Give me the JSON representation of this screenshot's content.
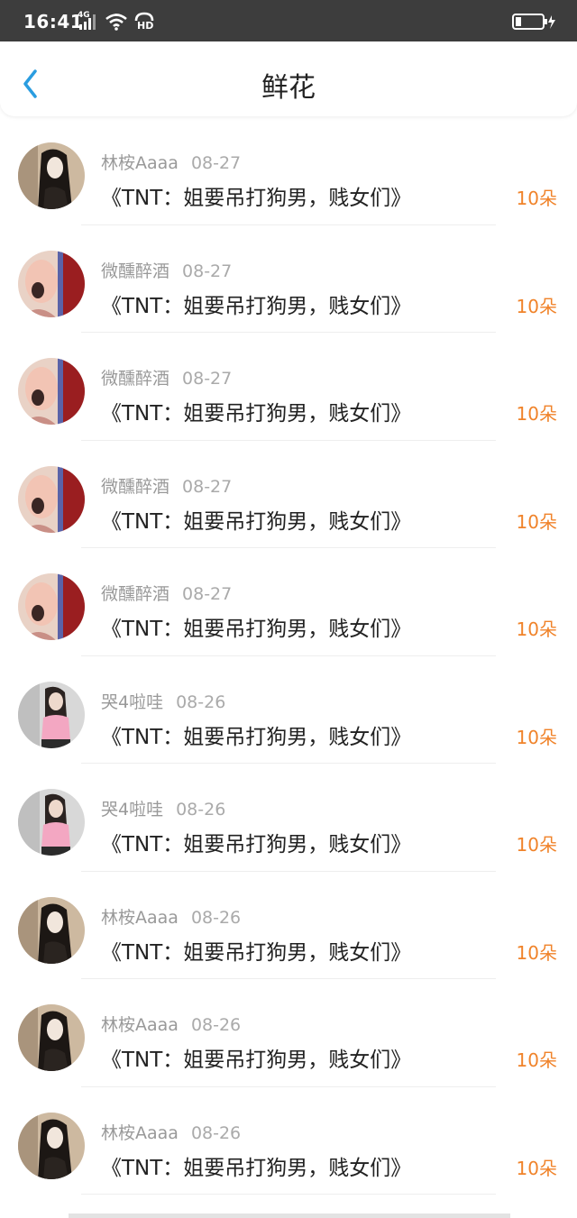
{
  "status_bar": {
    "time": "16:41",
    "network": "4G",
    "hd": "HD"
  },
  "header": {
    "title": "鲜花"
  },
  "items": [
    {
      "user": "林桉Aaaa",
      "date": "08-27",
      "book": "《TNT：姐要吊打狗男，贱女们》",
      "count": "10朵",
      "avatar": "avatar-dark-hair"
    },
    {
      "user": "微醺醉酒",
      "date": "08-27",
      "book": "《TNT：姐要吊打狗男，贱女们》",
      "count": "10朵",
      "avatar": "avatar-red-blur"
    },
    {
      "user": "微醺醉酒",
      "date": "08-27",
      "book": "《TNT：姐要吊打狗男，贱女们》",
      "count": "10朵",
      "avatar": "avatar-red-blur"
    },
    {
      "user": "微醺醉酒",
      "date": "08-27",
      "book": "《TNT：姐要吊打狗男，贱女们》",
      "count": "10朵",
      "avatar": "avatar-red-blur"
    },
    {
      "user": "微醺醉酒",
      "date": "08-27",
      "book": "《TNT：姐要吊打狗男，贱女们》",
      "count": "10朵",
      "avatar": "avatar-red-blur"
    },
    {
      "user": "哭4啦哇",
      "date": "08-26",
      "book": "《TNT：姐要吊打狗男，贱女们》",
      "count": "10朵",
      "avatar": "avatar-pink-top"
    },
    {
      "user": "哭4啦哇",
      "date": "08-26",
      "book": "《TNT：姐要吊打狗男，贱女们》",
      "count": "10朵",
      "avatar": "avatar-pink-top"
    },
    {
      "user": "林桉Aaaa",
      "date": "08-26",
      "book": "《TNT：姐要吊打狗男，贱女们》",
      "count": "10朵",
      "avatar": "avatar-dark-hair"
    },
    {
      "user": "林桉Aaaa",
      "date": "08-26",
      "book": "《TNT：姐要吊打狗男，贱女们》",
      "count": "10朵",
      "avatar": "avatar-dark-hair"
    },
    {
      "user": "林桉Aaaa",
      "date": "08-26",
      "book": "《TNT：姐要吊打狗男，贱女们》",
      "count": "10朵",
      "avatar": "avatar-dark-hair"
    }
  ],
  "colors": {
    "accent": "#f0832a",
    "back_icon": "#2a9de0",
    "status_bar": "#3d3d3d"
  }
}
